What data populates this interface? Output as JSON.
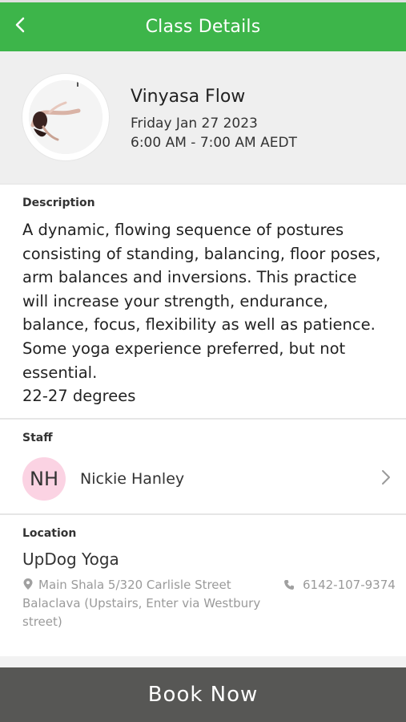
{
  "header": {
    "title": "Class Details",
    "back_icon": "chevron-left-icon"
  },
  "class": {
    "name": "Vinyasa Flow",
    "date": "Friday Jan 27 2023",
    "time": "6:00 AM - 7:00 AM AEDT"
  },
  "description": {
    "label": "Description",
    "lines": [
      "A dynamic, flowing sequence of postures",
      "consisting of standing, balancing, floor poses,",
      "arm balances and inversions. This practice",
      "will increase your strength, endurance,",
      "balance, focus, flexibility as well as patience.",
      "Some yoga experience preferred, but not",
      "essential.",
      "22-27 degrees"
    ]
  },
  "staff": {
    "label": "Staff",
    "initials": "NH",
    "name": "Nickie Hanley"
  },
  "location": {
    "label": "Location",
    "name": "UpDog Yoga",
    "address_lines": [
      "Main Shala 5/320 Carlisle Street",
      "Balaclava (Upstairs, Enter via Westbury",
      "street)"
    ],
    "phone": "6142-107-9374"
  },
  "book_button": {
    "label": "Book Now"
  },
  "colors": {
    "header": "#3db54a",
    "button": "#575755",
    "initials_bg": "#fbd3e3"
  }
}
